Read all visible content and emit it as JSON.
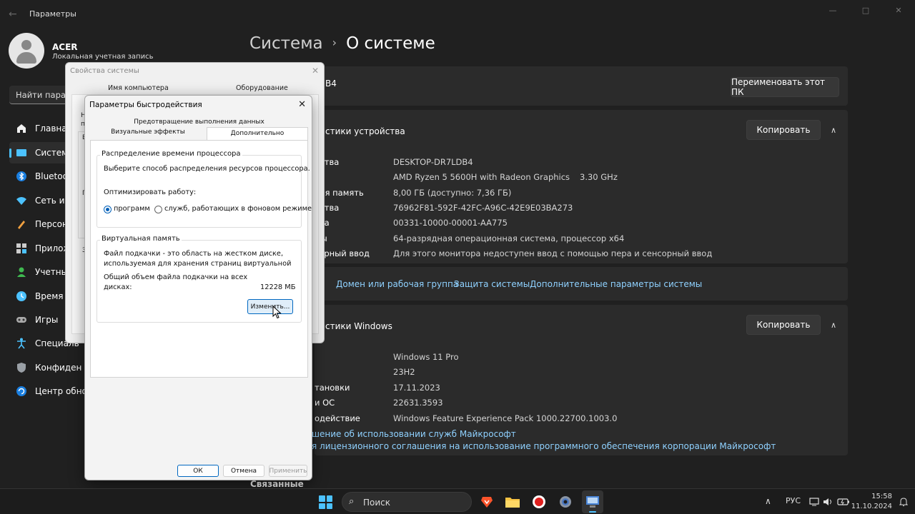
{
  "window": {
    "back_glyph": "←",
    "title": "Параметры",
    "min_glyph": "—",
    "max_glyph": "□",
    "close_glyph": "✕"
  },
  "profile": {
    "name": "ACER",
    "account_type": "Локальная учетная запись"
  },
  "search": {
    "text": "Найти парам"
  },
  "nav": {
    "items": [
      {
        "label": "Главная",
        "icon": "home-icon"
      },
      {
        "label": "Система",
        "icon": "system-icon",
        "active": true
      },
      {
        "label": "Bluetoot",
        "icon": "bluetooth-icon"
      },
      {
        "label": "Сеть и И",
        "icon": "network-icon"
      },
      {
        "label": "Персон",
        "icon": "personalization-icon"
      },
      {
        "label": "Прилож",
        "icon": "apps-icon"
      },
      {
        "label": "Учетные",
        "icon": "accounts-icon"
      },
      {
        "label": "Время и",
        "icon": "time-icon"
      },
      {
        "label": "Игры",
        "icon": "gaming-icon"
      },
      {
        "label": "Специаль",
        "icon": "accessibility-icon"
      },
      {
        "label": "Конфиден",
        "icon": "privacy-icon"
      },
      {
        "label": "Центр обнов",
        "icon": "update-icon"
      }
    ]
  },
  "breadcrumb": {
    "parent": "Система",
    "separator": "›",
    "current": "О системе"
  },
  "pc_card": {
    "name_fragment": "B4",
    "rename_button": "Переименовать этот ПК"
  },
  "device_specs": {
    "title": "стики устройства",
    "copy_button": "Копировать",
    "chevron": "∧",
    "rows": [
      {
        "label": "йства",
        "value": "DESKTOP-DR7LDB4"
      },
      {
        "label": "р",
        "value": "AMD Ryzen 5 5600H with Radeon Graphics",
        "extra": "3.30 GHz"
      },
      {
        "label": "ная память",
        "value": "8,00 ГБ (доступно: 7,36 ГБ)"
      },
      {
        "label": "йства",
        "value": "76962F81-592F-42FC-A96C-42E9E03BA273"
      },
      {
        "label": "кта",
        "value": "00331-10000-00001-AA775"
      },
      {
        "label": "мы",
        "value": "64-разрядная операционная система, процессор x64"
      },
      {
        "label": "сорный ввод",
        "value": "Для этого монитора недоступен ввод с помощью пера и сенсорный ввод"
      }
    ]
  },
  "related_links": {
    "domain": "Домен или рабочая группа",
    "protection": "Защита системы",
    "advanced": "Дополнительные параметры системы"
  },
  "windows_specs": {
    "title": "стики Windows",
    "copy_button": "Копировать",
    "chevron": "∧",
    "rows": [
      {
        "label": "",
        "value": "Windows 11 Pro"
      },
      {
        "label": "",
        "value": "23H2"
      },
      {
        "label": "тановки",
        "value": "17.11.2023"
      },
      {
        "label": "и ОС",
        "value": "22631.3593"
      },
      {
        "label": "одействие",
        "value": "Windows Feature Experience Pack 1000.22700.1003.0"
      }
    ],
    "link_services": "шение об использовании служб Майкрософт",
    "link_license": "я лицензионного соглашения на использование программного обеспечения корпорации Майкрософт"
  },
  "related_heading": "Связанные",
  "system_properties": {
    "title": "Свойства системы",
    "close_glyph": "✕",
    "tab_computer_name": "Имя компьютера",
    "tab_hardware": "Оборудование",
    "fragments": [
      "Н",
      "п",
      "В",
      "П",
      "П",
      "З"
    ]
  },
  "performance": {
    "title": "Параметры быстродействия",
    "close_glyph": "✕",
    "tab_dep": "Предотвращение выполнения данных",
    "tab_visual": "Визуальные эффекты",
    "tab_advanced": "Дополнительно",
    "cpu_group_title": "Распределение времени процессора",
    "cpu_desc": "Выберите способ распределения ресурсов процессора.",
    "optimize_label": "Оптимизировать работу:",
    "radio_programs": "программ",
    "radio_services": "служб, работающих в фоновом режиме",
    "vm_group_title": "Виртуальная память",
    "vm_desc_1": "Файл подкачки - это область на жестком диске,",
    "vm_desc_2": "используемая для хранения страниц виртуальной",
    "vm_total_1": "Общий объем файла подкачки на всех",
    "vm_total_2": "дисках:",
    "vm_size": "12228 МБ",
    "change_button": "Изменить...",
    "ok_button": "ОК",
    "cancel_button": "Отмена",
    "apply_button": "Применить"
  },
  "taskbar": {
    "search_label": "Поиск",
    "search_icon": "⌕",
    "tray_chevron": "∧",
    "language": "РУС",
    "time": "15:58",
    "date": "11.10.2024"
  },
  "colors": {
    "accent": "#4cc2ff",
    "link": "#8fd1ff",
    "dialog_accent": "#0067c0"
  }
}
